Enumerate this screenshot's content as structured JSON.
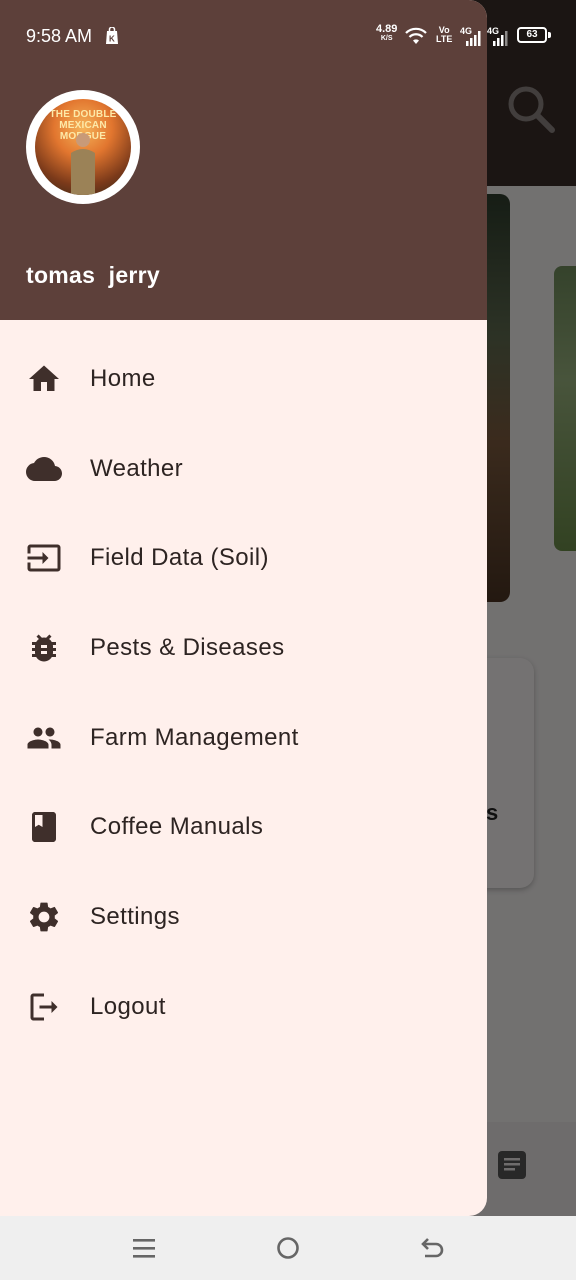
{
  "status_bar": {
    "time": "9:58 AM",
    "network_speed": "4.89",
    "network_speed_unit": "K/S",
    "volte_top": "Vo",
    "volte_bottom": "LTE",
    "signal1_label": "4G",
    "signal2_label": "4G",
    "battery": "63"
  },
  "drawer": {
    "avatar_title_line1": "THE DOUBLE",
    "avatar_title_line2": "MEXICAN MORGUE",
    "user_name": "tomas  jerry",
    "menu_items": [
      {
        "label": "Home",
        "icon": "home-icon"
      },
      {
        "label": "Weather",
        "icon": "cloud-icon"
      },
      {
        "label": "Field Data (Soil)",
        "icon": "input-icon"
      },
      {
        "label": "Pests & Diseases",
        "icon": "bug-icon"
      },
      {
        "label": "Farm Management",
        "icon": "people-icon"
      },
      {
        "label": "Coffee Manuals",
        "icon": "book-icon"
      },
      {
        "label": "Settings",
        "icon": "gear-icon"
      },
      {
        "label": "Logout",
        "icon": "logout-icon"
      }
    ]
  },
  "background": {
    "panel_text": "s"
  },
  "colors": {
    "drawer_header": "#5d403a",
    "drawer_body": "#fff0ec",
    "text": "#2d2422",
    "icon": "#3f2f2b"
  }
}
